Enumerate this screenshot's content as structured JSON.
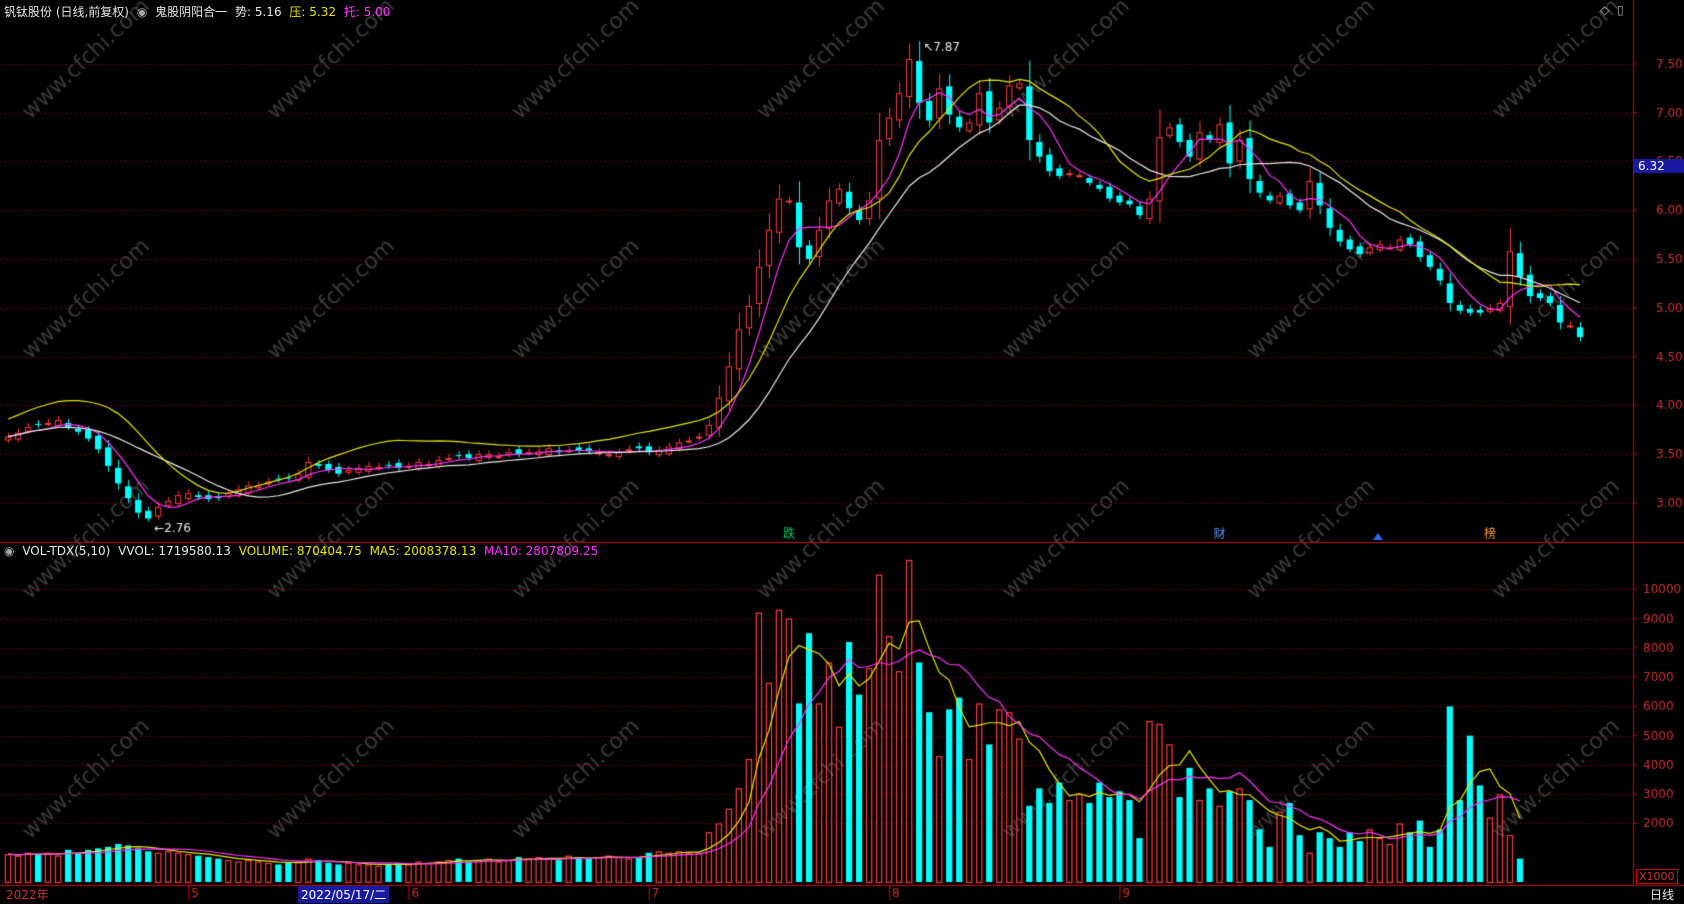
{
  "header": {
    "stock": "钒钛股份 (日线,前复权)",
    "indicator_name": "鬼股阴阳合一",
    "shi_label": "势:",
    "shi_value": "5.16",
    "ya_label": "压:",
    "ya_value": "5.32",
    "tuo_label": "托:",
    "tuo_value": "5.00"
  },
  "volume_header": {
    "name": "VOL-TDX(5,10)",
    "vvol": "VVOL: 1719580.13",
    "volume": "VOLUME: 870404.75",
    "ma5": "MA5: 2008378.13",
    "ma10": "MA10: 2807809.25"
  },
  "axis_bottom": {
    "year_label": "2022年",
    "months": [
      "5",
      "6",
      "7",
      "8",
      "9"
    ],
    "cursor_date": "2022/05/17/二",
    "period": "日线"
  },
  "price_axis": {
    "ticks": [
      "7.50",
      "7.00",
      "6.50",
      "6.00",
      "5.50",
      "5.00",
      "4.50",
      "4.00",
      "3.50",
      "3.00"
    ],
    "current": "6.32"
  },
  "volume_axis": {
    "ticks": [
      "10000",
      "9000",
      "8000",
      "7000",
      "6000",
      "5000",
      "4000",
      "3000",
      "2000"
    ],
    "unit": "X1000"
  },
  "annotations": {
    "high": "7.87",
    "low": "2.76"
  },
  "markers": [
    "跌",
    "财",
    "榜"
  ],
  "watermark": "www.cfchi.com",
  "colors": {
    "up": "#ff3b3b",
    "down": "#00ffff",
    "ma_white": "#e8e8e8",
    "ma_yellow": "#e6e600",
    "ma_magenta": "#ff33ff",
    "axis": "#cc0000",
    "grid": "#660000",
    "watermark": "#3a3a3a"
  },
  "chart_data": {
    "type": "candlestick",
    "price_ylim": [
      2.6,
      7.95
    ],
    "volume_ylim": [
      0,
      11000
    ],
    "closes": [
      3.68,
      3.72,
      3.78,
      3.8,
      3.82,
      3.85,
      3.78,
      3.73,
      3.66,
      3.55,
      3.38,
      3.2,
      3.05,
      2.9,
      2.84,
      2.96,
      3.02,
      3.08,
      3.1,
      3.06,
      3.04,
      3.05,
      3.1,
      3.14,
      3.18,
      3.18,
      3.22,
      3.24,
      3.26,
      3.3,
      3.42,
      3.38,
      3.34,
      3.3,
      3.34,
      3.36,
      3.38,
      3.37,
      3.38,
      3.36,
      3.38,
      3.42,
      3.4,
      3.44,
      3.46,
      3.48,
      3.46,
      3.5,
      3.5,
      3.48,
      3.52,
      3.5,
      3.52,
      3.53,
      3.56,
      3.52,
      3.54,
      3.54,
      3.53,
      3.52,
      3.5,
      3.52,
      3.55,
      3.56,
      3.52,
      3.54,
      3.58,
      3.62,
      3.64,
      3.68,
      3.8,
      4.08,
      4.4,
      4.78,
      5.02,
      5.42,
      5.8,
      6.12,
      6.1,
      5.62,
      5.5,
      5.8,
      6.1,
      6.22,
      6.02,
      5.9,
      6.1,
      6.72,
      6.95,
      7.2,
      7.55,
      7.1,
      6.92,
      7.25,
      6.98,
      6.85,
      6.9,
      7.2,
      6.9,
      7.05,
      7.28,
      7.3,
      6.72,
      6.55,
      6.4,
      6.35,
      6.38,
      6.36,
      6.28,
      6.22,
      6.12,
      6.08,
      6.06,
      5.95,
      6.12,
      6.75,
      6.85,
      6.7,
      6.55,
      6.8,
      6.72,
      6.88,
      6.48,
      6.72,
      6.32,
      6.18,
      6.1,
      6.15,
      6.05,
      6.0,
      6.3,
      6.05,
      5.82,
      5.68,
      5.6,
      5.55,
      5.62,
      5.65,
      5.62,
      5.7,
      5.65,
      5.52,
      5.42,
      5.28,
      5.05,
      4.97,
      4.95,
      4.95,
      5.0,
      5.05,
      5.58,
      5.32,
      5.12,
      5.1,
      5.05,
      4.85,
      4.82,
      4.7
    ],
    "volumes": [
      950,
      900,
      1000,
      950,
      1000,
      900,
      1100,
      1000,
      1100,
      1150,
      1200,
      1300,
      1250,
      1150,
      1050,
      1000,
      1050,
      1000,
      950,
      900,
      850,
      800,
      750,
      700,
      750,
      700,
      650,
      600,
      650,
      700,
      800,
      750,
      650,
      600,
      650,
      600,
      600,
      550,
      600,
      650,
      600,
      700,
      650,
      700,
      750,
      800,
      700,
      750,
      800,
      700,
      750,
      850,
      800,
      850,
      800,
      750,
      900,
      850,
      800,
      850,
      900,
      850,
      800,
      850,
      1000,
      1050,
      1000,
      1050,
      1000,
      1000,
      1700,
      2000,
      2500,
      3200,
      4200,
      9200,
      6800,
      9300,
      9000,
      6100,
      8500,
      6100,
      7500,
      5300,
      8200,
      6400,
      7300,
      10500,
      8400,
      7200,
      11000,
      7500,
      5800,
      4300,
      5900,
      6300,
      4200,
      6100,
      4700,
      5900,
      5800,
      4900,
      2600,
      3200,
      2700,
      3400,
      2800,
      3000,
      2700,
      3400,
      2900,
      3100,
      2800,
      1500,
      5500,
      5400,
      4700,
      2900,
      3900,
      2800,
      3200,
      2600,
      3100,
      3200,
      2800,
      1800,
      1200,
      2400,
      2700,
      1600,
      1000,
      1700,
      1500,
      1200,
      1700,
      1400,
      1800,
      1500,
      1300,
      2000,
      1700,
      2100,
      1200,
      1800,
      6000,
      2800,
      5000,
      3300,
      2200,
      3000,
      1600,
      800
    ]
  }
}
